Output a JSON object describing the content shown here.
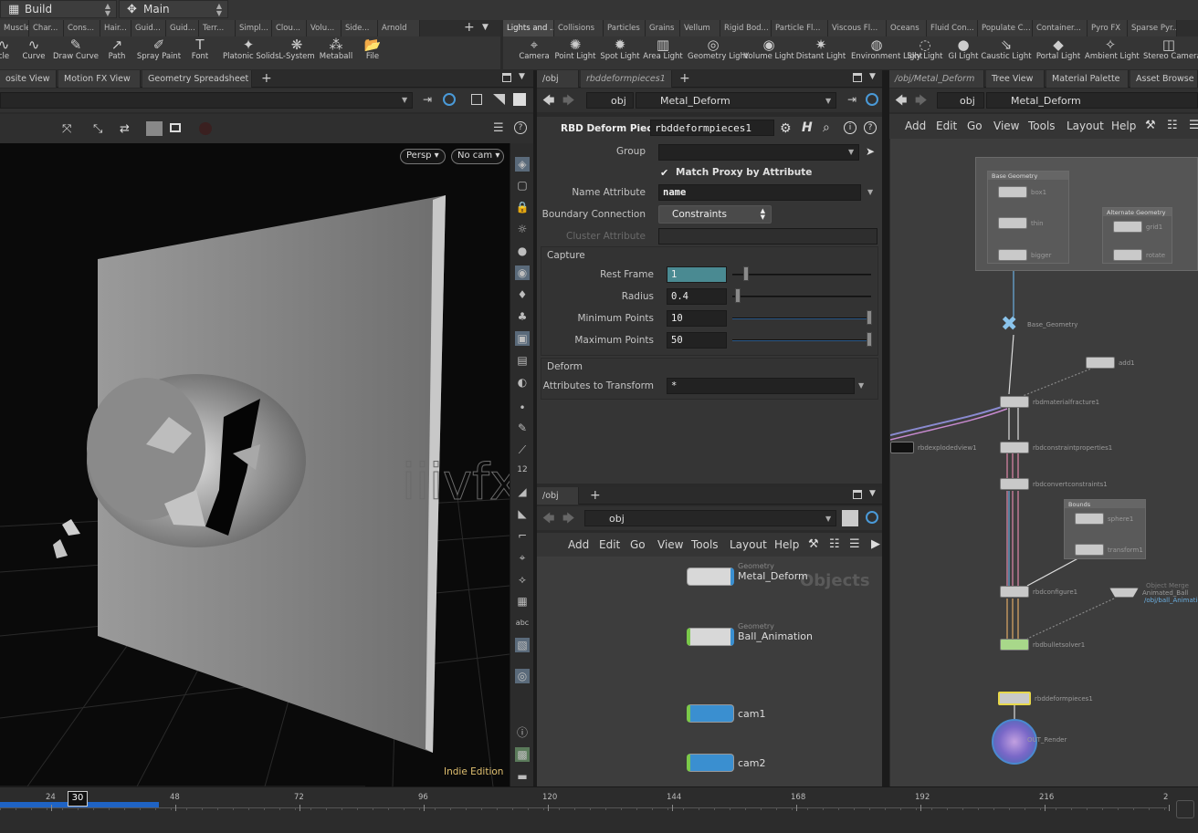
{
  "topbar": {
    "desktop": "Build",
    "context": "Main"
  },
  "left_shelf_tabs": [
    "Muscles",
    "Char...",
    "Cons...",
    "Hair...",
    "Guid...",
    "Guid...",
    "Terr...",
    "Simpl...",
    "Clou...",
    "Volu...",
    "Side...",
    "Arnold"
  ],
  "right_shelf_tabs": [
    "Lights and ...",
    "Collisions",
    "Particles",
    "Grains",
    "Vellum",
    "Rigid Bod...",
    "Particle Fl...",
    "Viscous Fl...",
    "Oceans",
    "Fluid Con...",
    "Populate C...",
    "Container...",
    "Pyro FX",
    "Sparse Pyr..."
  ],
  "left_tools": [
    "cle",
    "Curve",
    "Draw Curve",
    "Path",
    "Spray Paint",
    "Font",
    "Platonic Solids",
    "L-System",
    "Metaball",
    "File"
  ],
  "right_tools": [
    "Camera",
    "Point Light",
    "Spot Light",
    "Area Light",
    "Geometry Light",
    "Volume Light",
    "Distant Light",
    "Environment Light",
    "Sky Light",
    "GI Light",
    "Caustic Light",
    "Portal Light",
    "Ambient Light",
    "Stereo Camera"
  ],
  "viewport_pane": {
    "tabs": [
      "osite View",
      "Motion FX View",
      "Geometry Spreadsheet"
    ],
    "persp": "Persp",
    "cam": "No cam",
    "edition": "Indie Edition",
    "watermark": "iiivfx.com"
  },
  "params_pane": {
    "tabs": [
      "/obj",
      "rbddeformpieces1"
    ],
    "path": [
      "obj",
      "Metal_Deform"
    ],
    "node_type": "RBD Deform Pieces",
    "node_name": "rbddeformpieces1",
    "group_label": "Group",
    "match_proxy": "Match Proxy by Attribute",
    "name_attr_label": "Name Attribute",
    "name_attr_value": "name",
    "boundary_label": "Boundary Connection",
    "boundary_value": "Constraints",
    "cluster_label": "Cluster Attribute",
    "capture_title": "Capture",
    "rest_frame_label": "Rest Frame",
    "rest_frame_value": "1",
    "radius_label": "Radius",
    "radius_value": "0.4",
    "min_points_label": "Minimum Points",
    "min_points_value": "10",
    "max_points_label": "Maximum Points",
    "max_points_value": "50",
    "deform_title": "Deform",
    "attr_transform_label": "Attributes to Transform",
    "attr_transform_value": "*"
  },
  "obj_network": {
    "tabs": [
      "/obj"
    ],
    "path": "obj",
    "menu": [
      "Add",
      "Edit",
      "Go",
      "View",
      "Tools",
      "Layout",
      "Help"
    ],
    "watermark": "Objects",
    "nodes": [
      {
        "type": "Geometry",
        "name": "Metal_Deform"
      },
      {
        "type": "Geometry",
        "name": "Ball_Animation"
      },
      {
        "type": "",
        "name": "cam1"
      },
      {
        "type": "",
        "name": "cam2"
      }
    ]
  },
  "sop_network": {
    "tabs": [
      "/obj/Metal_Deform",
      "Tree View",
      "Material Palette",
      "Asset Browse"
    ],
    "path": [
      "obj",
      "Metal_Deform"
    ],
    "menu": [
      "Add",
      "Edit",
      "Go",
      "View",
      "Tools",
      "Layout",
      "Help"
    ],
    "boxes": [
      "Base Geometry",
      "Alternate Geometry",
      "Bounds"
    ],
    "nodes": [
      "box1",
      "thin",
      "bigger",
      "grid1",
      "rotate",
      "Base_Geometry",
      "add1",
      "rbdmaterialfracture1",
      "rbdexplodedview1",
      "rbdconstraintproperties1",
      "rbdconvertconstraints1",
      "sphere1",
      "transform1",
      "rbdconfigure1",
      "Animated_Ball",
      "rbdbulletsolver1",
      "rbddeformpieces1",
      "OUT_Render"
    ],
    "object_merge": "Object Merge",
    "object_merge_path": "/obj/ball_Animation"
  },
  "timeline": {
    "ticks": [
      "24",
      "48",
      "72",
      "96",
      "120",
      "144",
      "168",
      "192",
      "216",
      "2"
    ],
    "current_frame": "30",
    "progress": 0.133
  },
  "colors": {
    "accent": "#3a8fd0",
    "rest_frame_bg": "#4a8a92",
    "timeline_blue": "#1f63c4"
  }
}
